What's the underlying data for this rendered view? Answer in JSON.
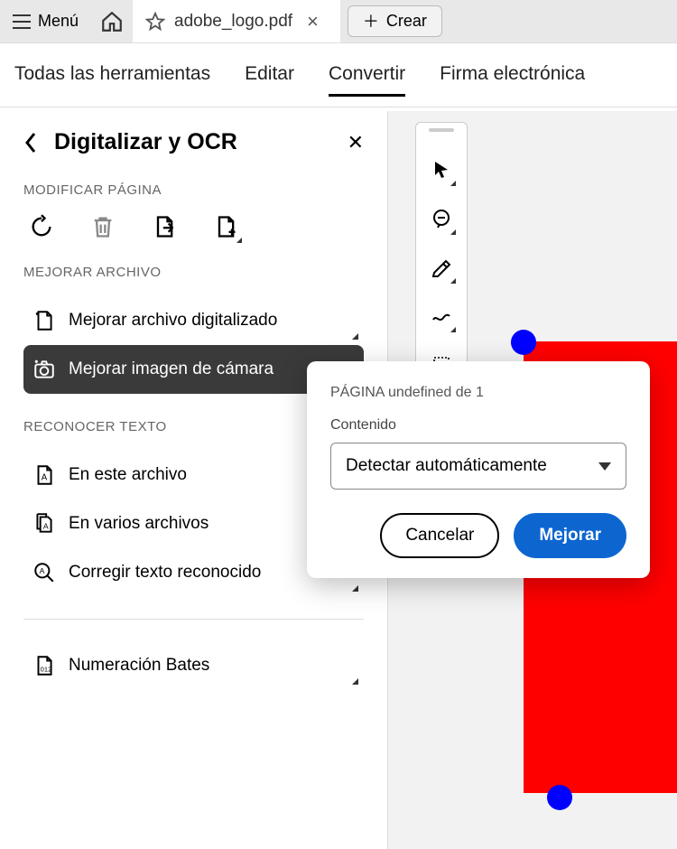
{
  "topbar": {
    "menu_label": "Menú",
    "tab_title": "adobe_logo.pdf",
    "create_label": "Crear"
  },
  "toolsrow": {
    "all_tools": "Todas las herramientas",
    "edit": "Editar",
    "convert": "Convertir",
    "sign": "Firma electrónica"
  },
  "panel": {
    "title": "Digitalizar y OCR",
    "section_modify": "MODIFICAR PÁGINA",
    "section_enhance": "MEJORAR ARCHIVO",
    "enhance_scanned": "Mejorar archivo digitalizado",
    "enhance_camera": "Mejorar imagen de cámara",
    "section_recognize": "RECONOCER TEXTO",
    "in_this_file": "En este archivo",
    "in_multiple": "En varios archivos",
    "correct_text": "Corregir texto reconocido",
    "bates": "Numeración Bates"
  },
  "dialog": {
    "page_label": "PÁGINA undefined de 1",
    "content_label": "Contenido",
    "select_value": "Detectar automáticamente",
    "cancel": "Cancelar",
    "improve": "Mejorar"
  }
}
